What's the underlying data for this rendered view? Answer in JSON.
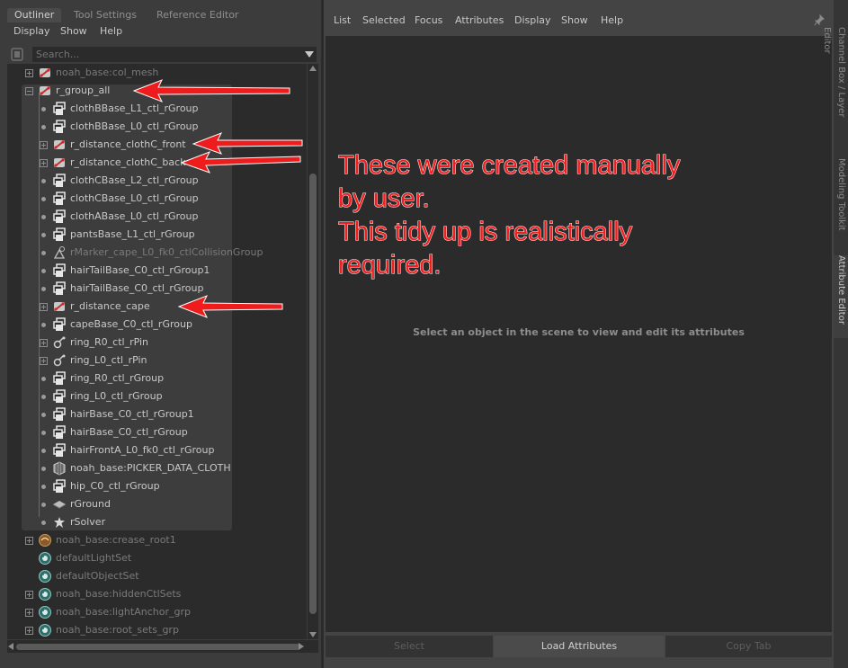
{
  "outliner": {
    "tabs": [
      "Outliner",
      "Tool Settings",
      "Reference Editor"
    ],
    "menu": [
      "Display",
      "Show",
      "Help"
    ],
    "search_placeholder": "Search...",
    "rows": [
      {
        "label": "noah_base:col_mesh",
        "icon": "distance-icon",
        "expander": "plus",
        "level": 0,
        "dim": true
      },
      {
        "label": "r_group_all",
        "icon": "distance-icon",
        "expander": "minus",
        "level": 0
      },
      {
        "label": "clothBBase_L1_ctl_rGroup",
        "icon": "group-icon",
        "level": 1
      },
      {
        "label": "clothBBase_L0_ctl_rGroup",
        "icon": "group-icon",
        "level": 1
      },
      {
        "label": "r_distance_clothC_front",
        "icon": "distance-icon",
        "expander": "plus",
        "level": 1
      },
      {
        "label": "r_distance_clothC_back",
        "icon": "distance-icon",
        "expander": "plus",
        "level": 1
      },
      {
        "label": "clothCBase_L2_ctl_rGroup",
        "icon": "group-icon",
        "level": 1
      },
      {
        "label": "clothCBase_L0_ctl_rGroup",
        "icon": "group-icon",
        "level": 1
      },
      {
        "label": "clothABase_L0_ctl_rGroup",
        "icon": "group-icon",
        "level": 1
      },
      {
        "label": "pantsBase_L1_ctl_rGroup",
        "icon": "group-icon",
        "level": 1
      },
      {
        "label": "rMarker_cape_L0_fk0_ctlCollisionGroup",
        "icon": "marker-icon",
        "level": 1,
        "dim": true
      },
      {
        "label": "hairTailBase_C0_ctl_rGroup1",
        "icon": "group-icon",
        "level": 1
      },
      {
        "label": "hairTailBase_C0_ctl_rGroup",
        "icon": "group-icon",
        "level": 1
      },
      {
        "label": "r_distance_cape",
        "icon": "distance-icon",
        "expander": "plus",
        "level": 1
      },
      {
        "label": "capeBase_C0_ctl_rGroup",
        "icon": "group-icon",
        "level": 1
      },
      {
        "label": "ring_R0_ctl_rPin",
        "icon": "pin-icon",
        "expander": "plus",
        "level": 1
      },
      {
        "label": "ring_L0_ctl_rPin",
        "icon": "pin-icon",
        "expander": "plus",
        "level": 1
      },
      {
        "label": "ring_R0_ctl_rGroup",
        "icon": "group-icon",
        "level": 1
      },
      {
        "label": "ring_L0_ctl_rGroup",
        "icon": "group-icon",
        "level": 1
      },
      {
        "label": "hairBase_C0_ctl_rGroup1",
        "icon": "group-icon",
        "level": 1
      },
      {
        "label": "hairBase_C0_ctl_rGroup",
        "icon": "group-icon",
        "level": 1
      },
      {
        "label": "hairFrontA_L0_fk0_ctl_rGroup",
        "icon": "group-icon",
        "level": 1
      },
      {
        "label": "noah_base:PICKER_DATA_CLOTH",
        "icon": "mesh-icon",
        "level": 1
      },
      {
        "label": "hip_C0_ctl_rGroup",
        "icon": "group-icon",
        "level": 1
      },
      {
        "label": "rGround",
        "icon": "ground-icon",
        "level": 1
      },
      {
        "label": "rSolver",
        "icon": "solver-icon",
        "level": 1
      },
      {
        "label": "noah_base:crease_root1",
        "icon": "crease-icon",
        "expander": "plus",
        "level": 0,
        "dim": true
      },
      {
        "label": "defaultLightSet",
        "icon": "set-icon",
        "level": 0,
        "dim": true
      },
      {
        "label": "defaultObjectSet",
        "icon": "set-icon",
        "level": 0,
        "dim": true
      },
      {
        "label": "noah_base:hiddenCtlSets",
        "icon": "set-icon",
        "expander": "plus",
        "level": 0,
        "dim": true
      },
      {
        "label": "noah_base:lightAnchor_grp",
        "icon": "set-icon",
        "expander": "plus",
        "level": 0,
        "dim": true
      },
      {
        "label": "noah_base:root_sets_grp",
        "icon": "set-icon",
        "expander": "plus",
        "level": 0,
        "dim": true
      }
    ]
  },
  "attribute_editor": {
    "menu": [
      "List",
      "Selected",
      "Focus",
      "Attributes",
      "Display",
      "Show",
      "Help"
    ],
    "empty_message": "Select an object in the scene to view and edit its attributes",
    "buttons": [
      "Select",
      "Load Attributes",
      "Copy Tab"
    ]
  },
  "side_tabs": [
    "Channel Box / Layer Editor",
    "Modeling Toolkit",
    "Attribute Editor"
  ],
  "annotation": {
    "lines": [
      "These were created manually",
      "by user.",
      "This tidy up is realistically",
      "required."
    ],
    "color": "#f01e1e"
  },
  "colors": {
    "panel": "#3c3c3c",
    "tree_bg": "#2b2b2b",
    "highlight": "#3d3d3d",
    "arrow": "#ee1c1c"
  }
}
